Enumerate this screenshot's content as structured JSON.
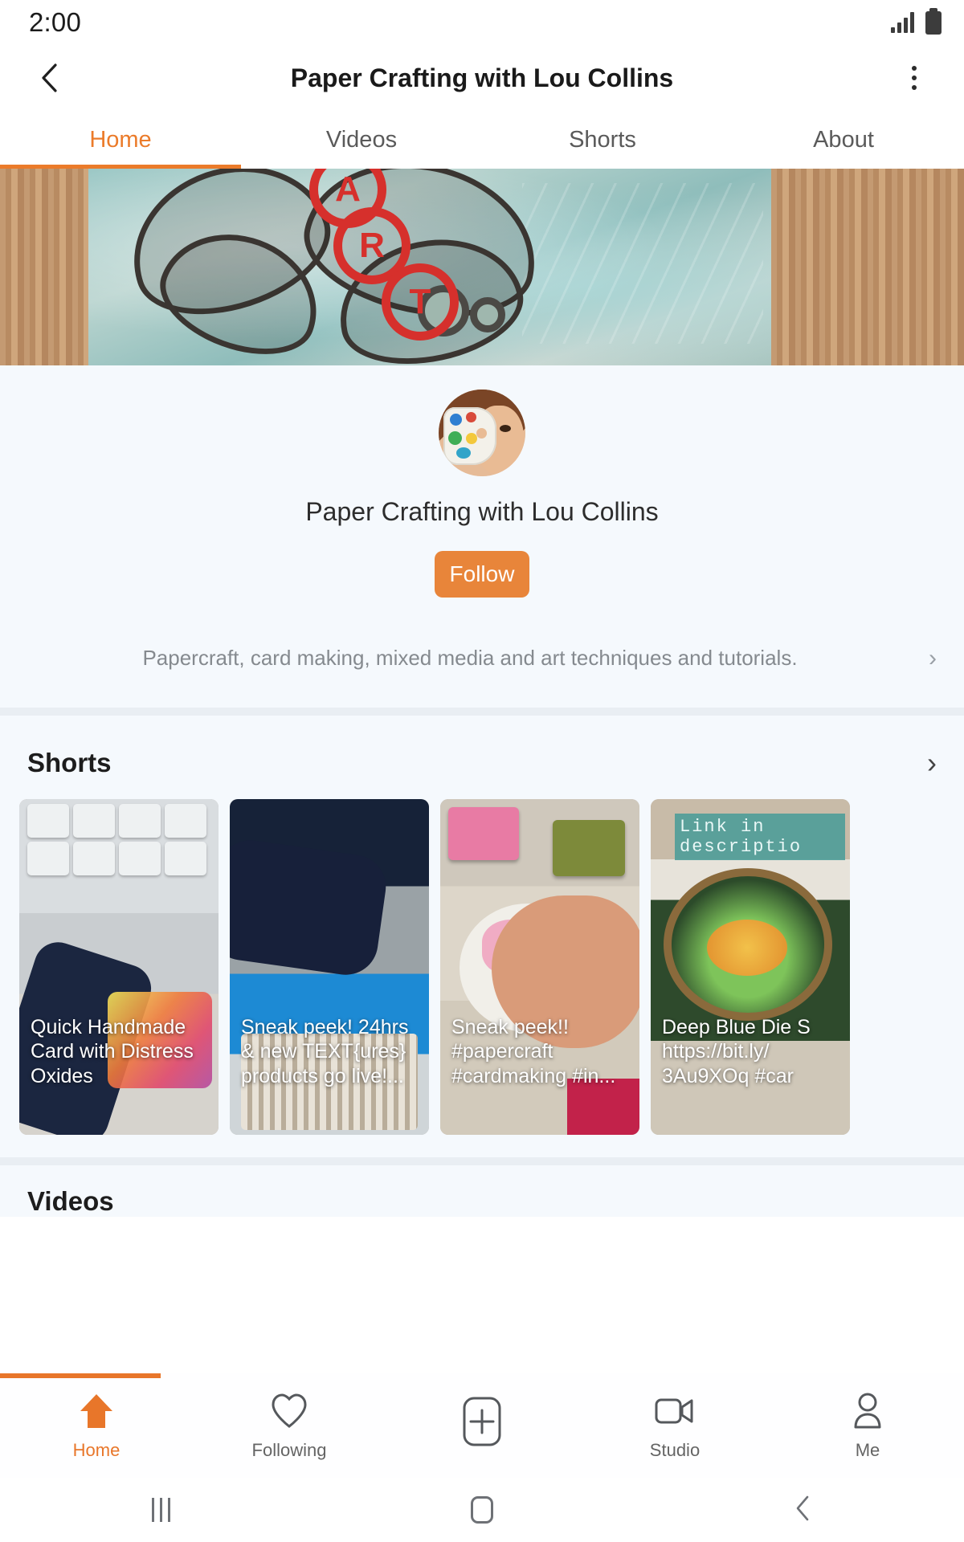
{
  "status_bar": {
    "time": "2:00",
    "signal_icon": "signal-bars-icon",
    "battery_icon": "battery-full-icon"
  },
  "app_bar": {
    "back_icon": "chevron-left-icon",
    "title": "Paper Crafting with Lou Collins",
    "overflow_icon": "more-vertical-icon"
  },
  "tabs": [
    {
      "label": "Home",
      "active": true
    },
    {
      "label": "Videos",
      "active": false
    },
    {
      "label": "Shorts",
      "active": false
    },
    {
      "label": "About",
      "active": false
    }
  ],
  "profile": {
    "avatar_alt": "profile-avatar",
    "name": "Paper Crafting with Lou Collins",
    "follow_label": "Follow",
    "description": "Papercraft, card making, mixed media and art techniques and tutorials.",
    "description_chevron": "chevron-right-icon"
  },
  "shorts_section": {
    "title": "Shorts",
    "see_all_icon": "chevron-right-icon",
    "cards": [
      {
        "caption": "Quick Handmade Card with Distress Oxides",
        "overlay_text": ""
      },
      {
        "caption": "Sneak peek! 24hrs & new TEXT{ures} products go live!...",
        "overlay_text": ""
      },
      {
        "caption": "Sneak peek!! #papercraft #cardmaking #in...",
        "overlay_text": ""
      },
      {
        "caption": "Deep Blue Die S https://bit.ly/ 3Au9XOq #car",
        "overlay_text": "Link in descriptio"
      }
    ]
  },
  "videos_section": {
    "title": "Videos"
  },
  "bottom_nav": [
    {
      "label": "Home",
      "icon": "home-icon",
      "active": true
    },
    {
      "label": "Following",
      "icon": "heart-icon",
      "active": false
    },
    {
      "label": "",
      "icon": "plus-box-icon",
      "active": false
    },
    {
      "label": "Studio",
      "icon": "video-camera-icon",
      "active": false
    },
    {
      "label": "Me",
      "icon": "person-icon",
      "active": false
    }
  ],
  "system_nav": [
    {
      "icon": "recents-icon"
    },
    {
      "icon": "home-square-icon"
    },
    {
      "icon": "back-chevron-icon"
    }
  ],
  "colors": {
    "accent": "#e8762a",
    "follow_button": "#e8853a",
    "panel_bg": "#f5f9fd",
    "divider": "#e9eef3"
  }
}
